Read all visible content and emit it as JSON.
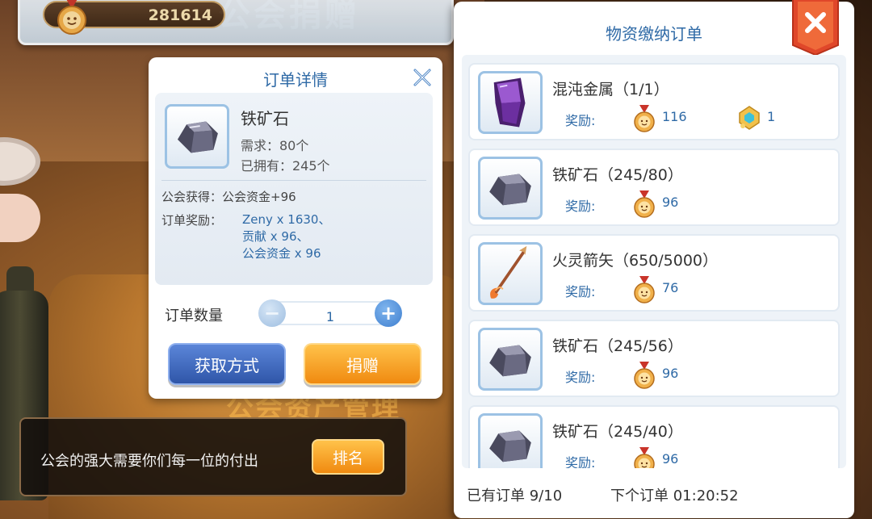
{
  "header": {
    "guild_funds": "281614"
  },
  "detail": {
    "title": "订单详情",
    "item_name": "铁矿石",
    "need": "需求：80个",
    "have": "已拥有：245个",
    "gain": "公会获得：公会资金+96",
    "reward_label": "订单奖励：",
    "rewards": [
      "Zeny x 1630、",
      "贡献 x 96、",
      "公会资金 x 96"
    ],
    "qty_label": "订单数量",
    "qty_value": "1",
    "btn_obtain": "获取方式",
    "btn_donate": "捐赠"
  },
  "message": {
    "text": "公会的强大需要你们每一位的付出",
    "rank_button": "排名"
  },
  "orders_panel": {
    "title": "物资缴纳订单",
    "reward_label": "奖励:",
    "orders": [
      {
        "name": "混沌金属（1/1）",
        "reward": "116",
        "extra_reward": "1"
      },
      {
        "name": "铁矿石（245/80）",
        "reward": "96"
      },
      {
        "name": "火灵箭矢（650/5000）",
        "reward": "76"
      },
      {
        "name": "铁矿石（245/56）",
        "reward": "96"
      },
      {
        "name": "铁矿石（245/40）",
        "reward": "96"
      }
    ],
    "status_orders": "已有订单  9/10",
    "status_next": "下个订单  01:20:52"
  },
  "colors": {
    "accent_blue": "#2f6aa6",
    "button_orange": "#f08a10",
    "button_blue": "#2f56a8",
    "close_red": "#e0472a"
  }
}
